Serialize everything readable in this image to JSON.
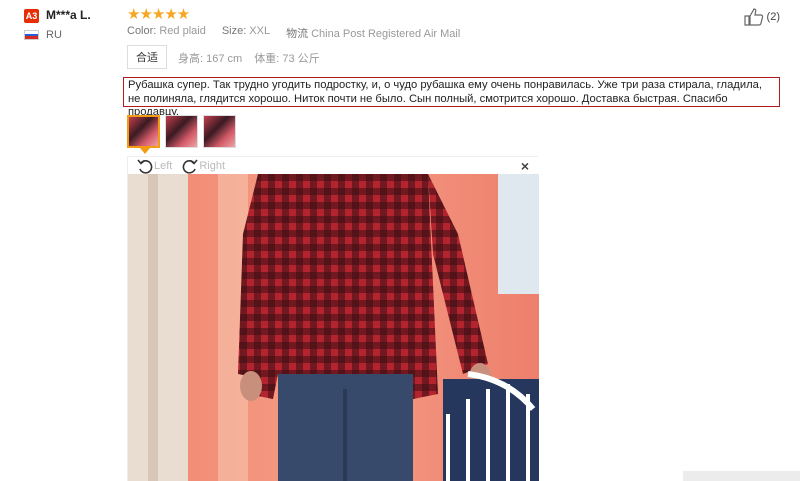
{
  "user": {
    "badge": "A3",
    "name": "M***a L.",
    "country": "RU",
    "flag_colors": [
      "#ffffff",
      "#2a5bd7",
      "#d52b1e"
    ]
  },
  "rating": {
    "stars": 5,
    "display": "★★★★★",
    "color": "#f6a623"
  },
  "likes": {
    "icon": "thumbs-up-icon",
    "count": "(2)"
  },
  "attributes": {
    "color_label": "Color:",
    "color_value": "Red plaid",
    "size_label": "Size:",
    "size_value": "XXL",
    "logistics_label": "物流",
    "logistics_value": "China Post Registered Air Mail"
  },
  "fit": {
    "tag": "合适",
    "height_label": "身高:",
    "height_value": "167 cm",
    "weight_label": "体重:",
    "weight_value": "73 公斤"
  },
  "review": {
    "text": "Рубашка супер. Так трудно угодить подростку, и, о чудо рубашка ему очень понравилась. Уже три раза стирала, гладила, не полиняла, глядится хорошо. Ниток почти не было. Сын полный, смотрится хорошо. Доставка быстрая. Спасибо продавцу.",
    "border_color": "#b21c1c"
  },
  "viewer": {
    "rotate_left": "Left",
    "rotate_right": "Right",
    "close": "×",
    "thumbnails": 3,
    "active_thumbnail": 1
  }
}
